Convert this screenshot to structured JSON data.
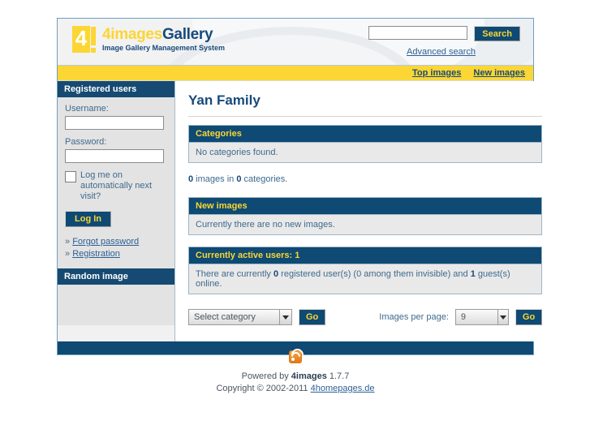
{
  "header": {
    "logo": {
      "mark_char": "4",
      "title_part1": "4images",
      "title_part2": "Gallery",
      "subtitle": "Image Gallery Management System"
    },
    "search": {
      "value": "",
      "placeholder": "",
      "button_label": "Search",
      "advanced_label": "Advanced search"
    }
  },
  "navbar": {
    "items": [
      {
        "label": "Top images"
      },
      {
        "label": "New images"
      }
    ]
  },
  "sidebar": {
    "registered_users": {
      "title": "Registered users",
      "username_label": "Username:",
      "username_value": "",
      "password_label": "Password:",
      "password_value": "",
      "remember_label": "Log me on automatically next visit?",
      "login_label": "Log In",
      "links": [
        {
          "bullet": "»",
          "label": "Forgot password"
        },
        {
          "bullet": "»",
          "label": "Registration"
        }
      ]
    },
    "random_image": {
      "title": "Random image"
    }
  },
  "main": {
    "page_title": "Yan Family",
    "categories_box": {
      "title": "Categories",
      "body": "No categories found."
    },
    "stats": {
      "images_count": "0",
      "images_word": " images in ",
      "categories_count": "0",
      "categories_word": " categories."
    },
    "new_images_box": {
      "title": "New images",
      "body": "Currently there are no new images."
    },
    "active_users_box": {
      "title": "Currently active users: 1",
      "text_before": "There are currently ",
      "registered_count": "0",
      "text_middle": " registered user(s) (0 among them invisible) and ",
      "guest_count": "1",
      "text_after": " guest(s) online."
    },
    "controls": {
      "category_select_value": "Select category",
      "category_go_label": "Go",
      "images_per_page_label": "Images per page:",
      "images_per_page_value": "9",
      "images_per_page_go_label": "Go"
    }
  },
  "footer": {
    "rss_icon": "rss-icon",
    "powered_prefix": "Powered by ",
    "powered_name": "4images",
    "powered_version": " 1.7.7",
    "copyright_prefix": "Copyright © 2002-2011 ",
    "copyright_link": "4homepages.de"
  },
  "colors": {
    "brand_yellow": "#fbd634",
    "brand_blue": "#0e4a73",
    "panel_head_blue": "#164a72",
    "link_blue": "#2c5f96",
    "body_gray": "#e9e9e9",
    "sidebar_gray": "#e3e3e3",
    "rss_orange": "#e07a18"
  }
}
